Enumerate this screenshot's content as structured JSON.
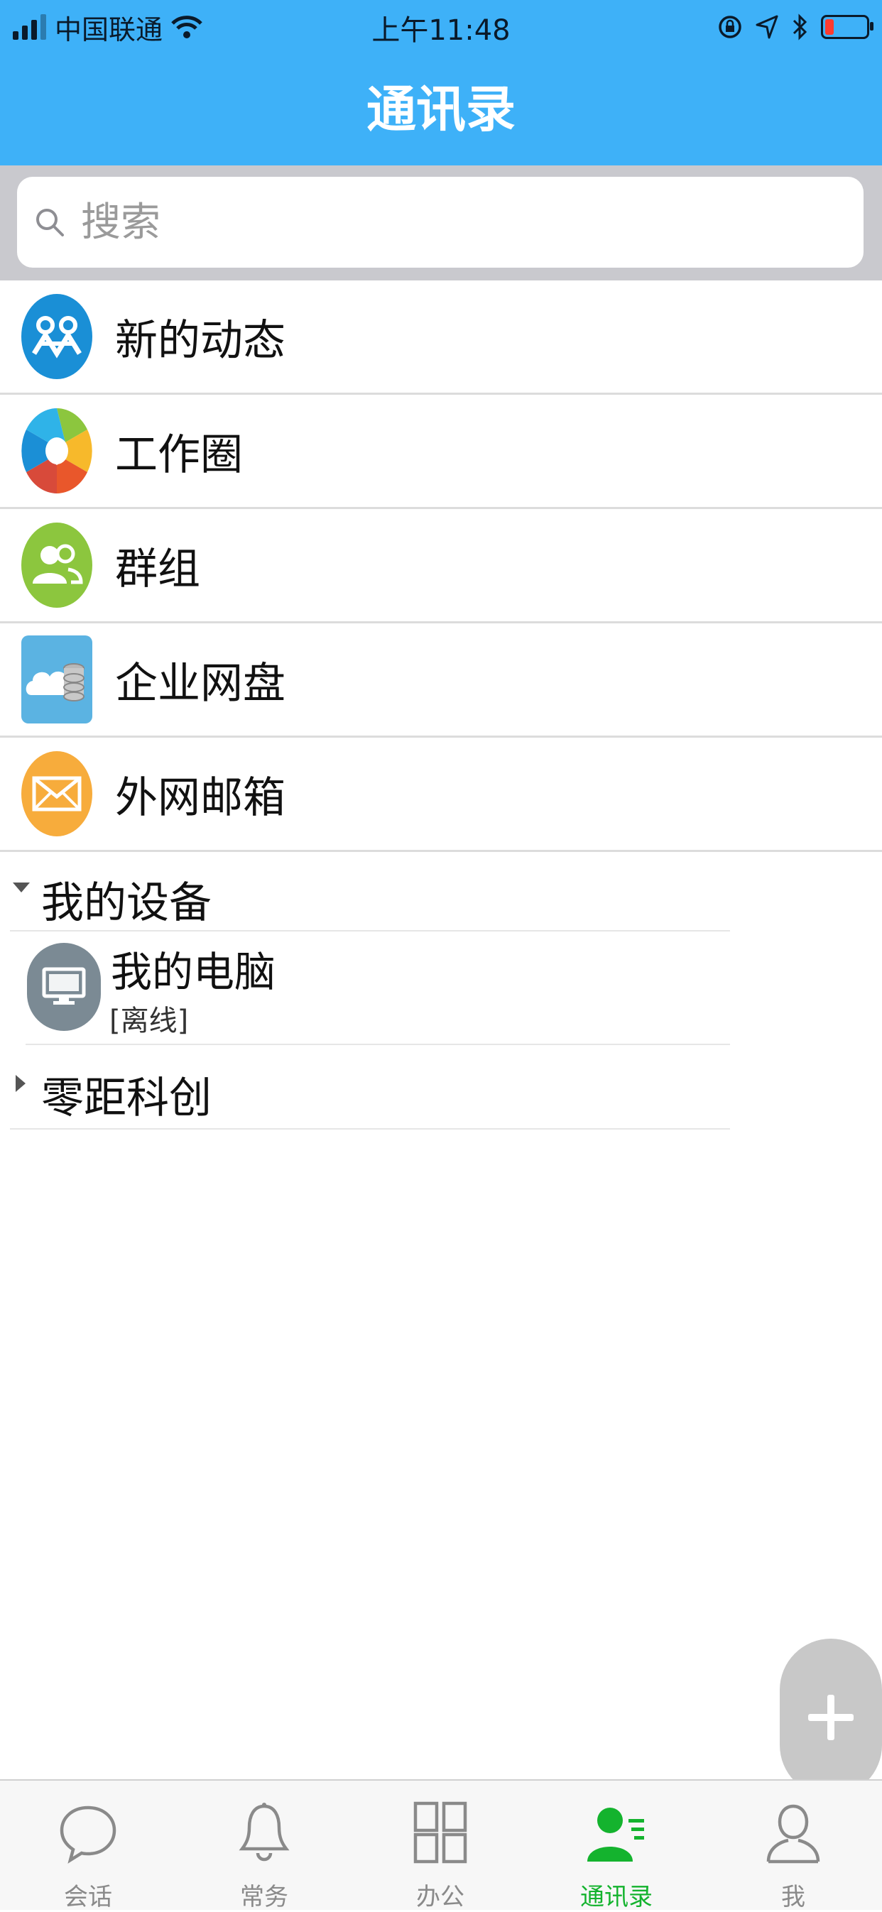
{
  "status_bar": {
    "carrier": "中国联通",
    "time": "上午11:48"
  },
  "header": {
    "title": "通讯录"
  },
  "search": {
    "placeholder": "搜索"
  },
  "menu": [
    {
      "label": "新的动态",
      "icon": "new-activity-icon"
    },
    {
      "label": "工作圈",
      "icon": "work-circle-icon"
    },
    {
      "label": "群组",
      "icon": "group-icon"
    },
    {
      "label": "企业网盘",
      "icon": "enterprise-disk-icon"
    },
    {
      "label": "外网邮箱",
      "icon": "external-mail-icon"
    }
  ],
  "tree": {
    "groups": [
      {
        "label": "我的设备",
        "expanded": true,
        "devices": [
          {
            "name": "我的电脑",
            "status": "[离线]",
            "icon": "computer-icon"
          }
        ]
      },
      {
        "label": "零距科创",
        "expanded": false
      }
    ]
  },
  "tabbar": {
    "tabs": [
      {
        "label": "会话",
        "icon": "chat-bubble-icon"
      },
      {
        "label": "常务",
        "icon": "bell-icon"
      },
      {
        "label": "办公",
        "icon": "grid-icon"
      },
      {
        "label": "通讯录",
        "icon": "contacts-icon",
        "active": true
      },
      {
        "label": "我",
        "icon": "person-icon"
      }
    ]
  },
  "colors": {
    "header_bg": "#3eb1f8",
    "active_tab": "#14b32e",
    "inactive_tab": "#8a8a8a"
  }
}
